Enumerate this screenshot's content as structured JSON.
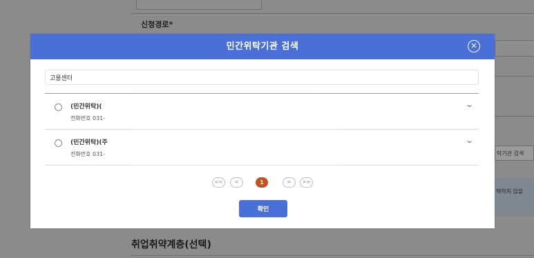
{
  "background": {
    "field_label": "신청경로",
    "required_mark": "*",
    "side_button_label": "탁기관 검색",
    "side_note_text": "택하지 않을",
    "section_title": "취업취약계층(선택)"
  },
  "modal": {
    "title": "민간위탁기관 검색",
    "search": {
      "value": "고용센터"
    },
    "results": [
      {
        "name": "(민간위탁)(",
        "phone": "전화번호 031-"
      },
      {
        "name": "(민간위탁)(주",
        "phone": "전화번호 031-"
      }
    ],
    "pagination": {
      "first": "<<",
      "prev": "<",
      "current": "1",
      "next": ">",
      "last": ">>"
    },
    "confirm_label": "확인"
  },
  "colors": {
    "header_blue": "#4a6fd6",
    "active_page": "#c4521f",
    "overlay_gray": "#8b8b8b"
  }
}
